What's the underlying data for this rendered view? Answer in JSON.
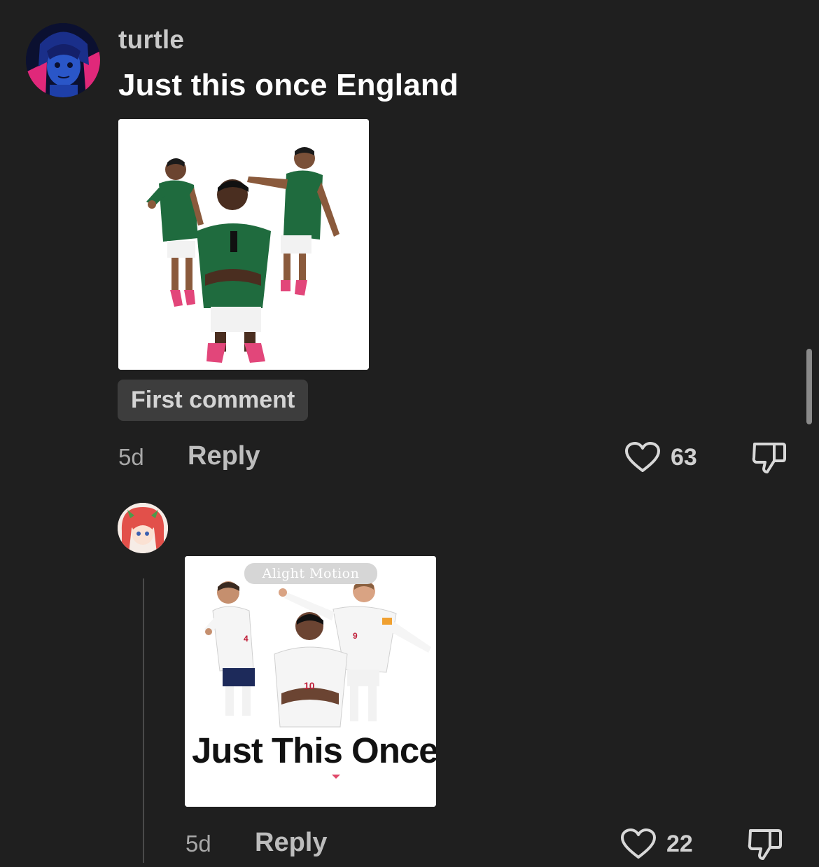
{
  "comments": [
    {
      "username": "turtle",
      "text": "Just this once England",
      "badge": "First comment",
      "time": "5d",
      "reply_label": "Reply",
      "likes": "63"
    },
    {
      "time": "5d",
      "reply_label": "Reply",
      "likes": "22",
      "image": {
        "watermark": "Alight Motion",
        "caption": "Just This Once"
      }
    }
  ],
  "icons": {
    "like": "heart-outline-icon",
    "dislike": "thumbs-down-icon"
  },
  "colors": {
    "background": "#1f1f1f",
    "mexico_jersey": "#1f6b3e",
    "england_jersey": "#f5f5f5"
  }
}
